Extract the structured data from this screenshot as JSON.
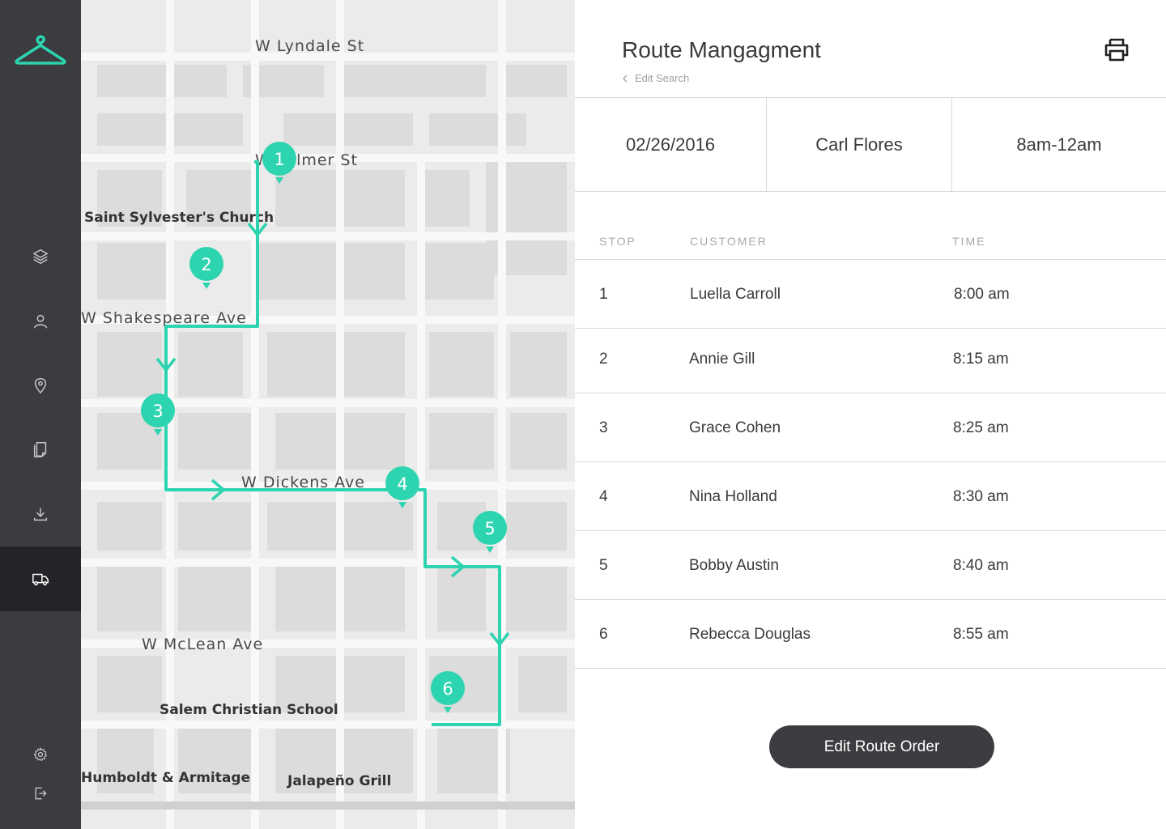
{
  "colors": {
    "accent": "#2dd4b0",
    "sidebar": "#3b3c40",
    "sidebar_active": "#232427",
    "button": "#3d3d41"
  },
  "sidebar": {
    "logo_icon": "hanger-icon",
    "items": [
      {
        "name": "layers-icon",
        "active": false
      },
      {
        "name": "user-icon",
        "active": false
      },
      {
        "name": "location-pin-icon",
        "active": false
      },
      {
        "name": "documents-icon",
        "active": false
      },
      {
        "name": "download-icon",
        "active": false
      },
      {
        "name": "truck-icon",
        "active": true
      }
    ],
    "bottom_items": [
      {
        "name": "gear-icon"
      },
      {
        "name": "logout-icon"
      }
    ]
  },
  "map": {
    "streets": [
      "W Lyndale St",
      "W Palmer St",
      "W Shakespeare Ave",
      "W Dickens Ave",
      "W McLean Ave"
    ],
    "pois": [
      "Saint Sylvester's Church",
      "Salem Christian School",
      "Jalapeño Grill",
      "Humboldt & Armitage"
    ],
    "markers": [
      "1",
      "2",
      "3",
      "4",
      "5",
      "6"
    ]
  },
  "header": {
    "title": "Route Mangagment",
    "edit_search": "Edit Search",
    "print_icon": "printer-icon"
  },
  "info": {
    "date": "02/26/2016",
    "driver": "Carl Flores",
    "window": "8am-12am"
  },
  "table": {
    "headers": {
      "stop": "STOP",
      "customer": "CUSTOMER",
      "time": "TIME"
    },
    "rows": [
      {
        "stop": "1",
        "customer": "Luella Carroll",
        "time": "8:00 am"
      },
      {
        "stop": "2",
        "customer": "Annie Gill",
        "time": "8:15 am"
      },
      {
        "stop": "3",
        "customer": "Grace Cohen",
        "time": "8:25 am"
      },
      {
        "stop": "4",
        "customer": "Nina Holland",
        "time": "8:30 am"
      },
      {
        "stop": "5",
        "customer": "Bobby Austin",
        "time": "8:40 am"
      },
      {
        "stop": "6",
        "customer": "Rebecca Douglas",
        "time": "8:55 am"
      }
    ]
  },
  "edit_route_button": "Edit Route Order"
}
